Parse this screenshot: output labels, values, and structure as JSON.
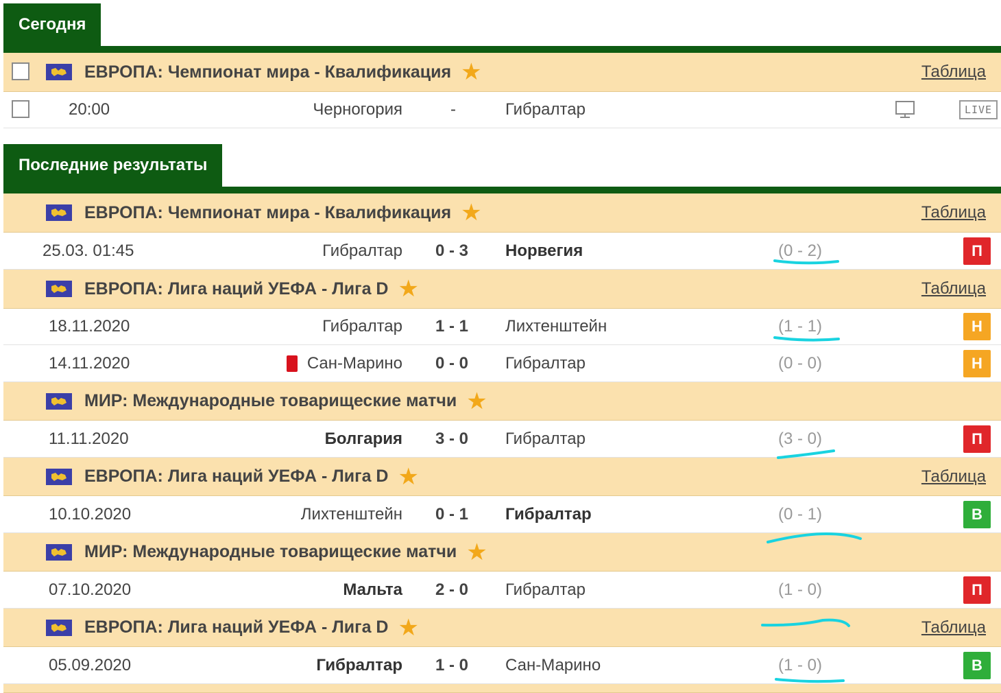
{
  "sections": {
    "today": {
      "title": "Сегодня"
    },
    "results": {
      "title": "Последние результаты"
    }
  },
  "colors": {
    "section_green": "#0e5b12",
    "league_bg": "#fbe1ae",
    "star": "#f2a81a",
    "loss": "#e0262a",
    "draw": "#f5a623",
    "win": "#2fae3a",
    "highlight": "#19d3e0"
  },
  "icons": {
    "flag": "europe-flag-icon",
    "star": "star-icon",
    "tv": "tv-icon",
    "live": "live-icon",
    "red_card": "red-card-icon"
  },
  "today": {
    "league": {
      "name": "ЕВРОПА: Чемпионат мира - Квалификация",
      "link": "Таблица"
    },
    "match": {
      "time": "20:00",
      "home": "Черногория",
      "separator": "-",
      "away": "Гибралтар",
      "live_label": "LIVE"
    }
  },
  "results": {
    "leagues": [
      {
        "name": "ЕВРОПА: Чемпионат мира - Квалификация",
        "link": "Таблица"
      },
      {
        "name": "ЕВРОПА: Лига наций УЕФА - Лига D",
        "link": "Таблица"
      },
      {
        "name": "МИР: Международные товарищеские матчи"
      },
      {
        "name": "ЕВРОПА: Лига наций УЕФА - Лига D",
        "link": "Таблица"
      },
      {
        "name": "МИР: Международные товарищеские матчи"
      },
      {
        "name": "ЕВРОПА: Лига наций УЕФА - Лига D",
        "link": "Таблица"
      }
    ],
    "matches": [
      {
        "date": "25.03. 01:45",
        "home": "Гибралтар",
        "score": "0 - 3",
        "away": "Норвегия",
        "halftime": "(0 - 2)",
        "result": "П"
      },
      {
        "date": "18.11.2020",
        "home": "Гибралтар",
        "score": "1 - 1",
        "away": "Лихтенштейн",
        "halftime": "(1 - 1)",
        "result": "Н"
      },
      {
        "date": "14.11.2020",
        "home": "Сан-Марино",
        "score": "0 - 0",
        "away": "Гибралтар",
        "halftime": "(0 - 0)",
        "result": "Н"
      },
      {
        "date": "11.11.2020",
        "home": "Болгария",
        "score": "3 - 0",
        "away": "Гибралтар",
        "halftime": "(3 - 0)",
        "result": "П"
      },
      {
        "date": "10.10.2020",
        "home": "Лихтенштейн",
        "score": "0 - 1",
        "away": "Гибралтар",
        "halftime": "(0 - 1)",
        "result": "В"
      },
      {
        "date": "07.10.2020",
        "home": "Мальта",
        "score": "2 - 0",
        "away": "Гибралтар",
        "halftime": "(1 - 0)",
        "result": "П"
      },
      {
        "date": "05.09.2020",
        "home": "Гибралтар",
        "score": "1 - 0",
        "away": "Сан-Марино",
        "halftime": "(1 - 0)",
        "result": "В"
      }
    ]
  }
}
